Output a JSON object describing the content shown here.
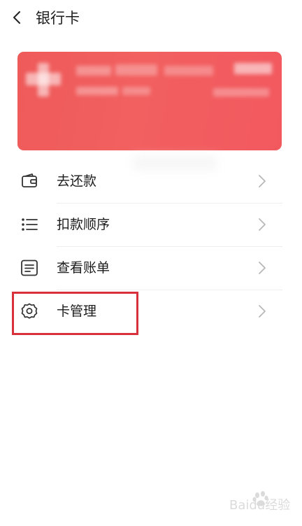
{
  "header": {
    "back_icon": "chevron-left-icon",
    "title": "银行卡"
  },
  "card": {
    "background_color": "#f05b5f",
    "details_obscured": true
  },
  "menu": {
    "items": [
      {
        "label": "去还款",
        "icon": "wallet-icon"
      },
      {
        "label": "扣款顺序",
        "icon": "list-icon"
      },
      {
        "label": "查看账单",
        "icon": "bill-icon"
      },
      {
        "label": "卡管理",
        "icon": "gear-icon"
      }
    ],
    "chevron_icon": "chevron-right-icon"
  },
  "annotation": {
    "highlight_color": "#d8313b",
    "highlighted_item": "卡管理"
  },
  "watermark": {
    "text": "Baidu经验"
  }
}
